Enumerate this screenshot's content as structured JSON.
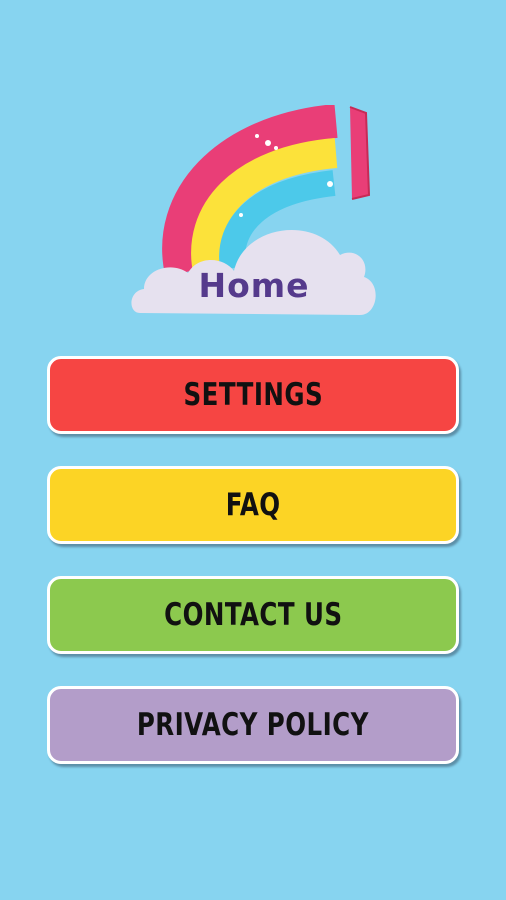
{
  "header": {
    "title": "Home",
    "logo_icon": "rainbow-cloud-icon"
  },
  "menu": {
    "items": [
      {
        "label": "SETTINGS",
        "color": "#f64543"
      },
      {
        "label": "FAQ",
        "color": "#fcd425"
      },
      {
        "label": "CONTACT US",
        "color": "#8cc94e"
      },
      {
        "label": "PRIVACY POLICY",
        "color": "#b39dc9"
      }
    ]
  },
  "colors": {
    "background": "#87d4f0",
    "title": "#553a8c"
  }
}
